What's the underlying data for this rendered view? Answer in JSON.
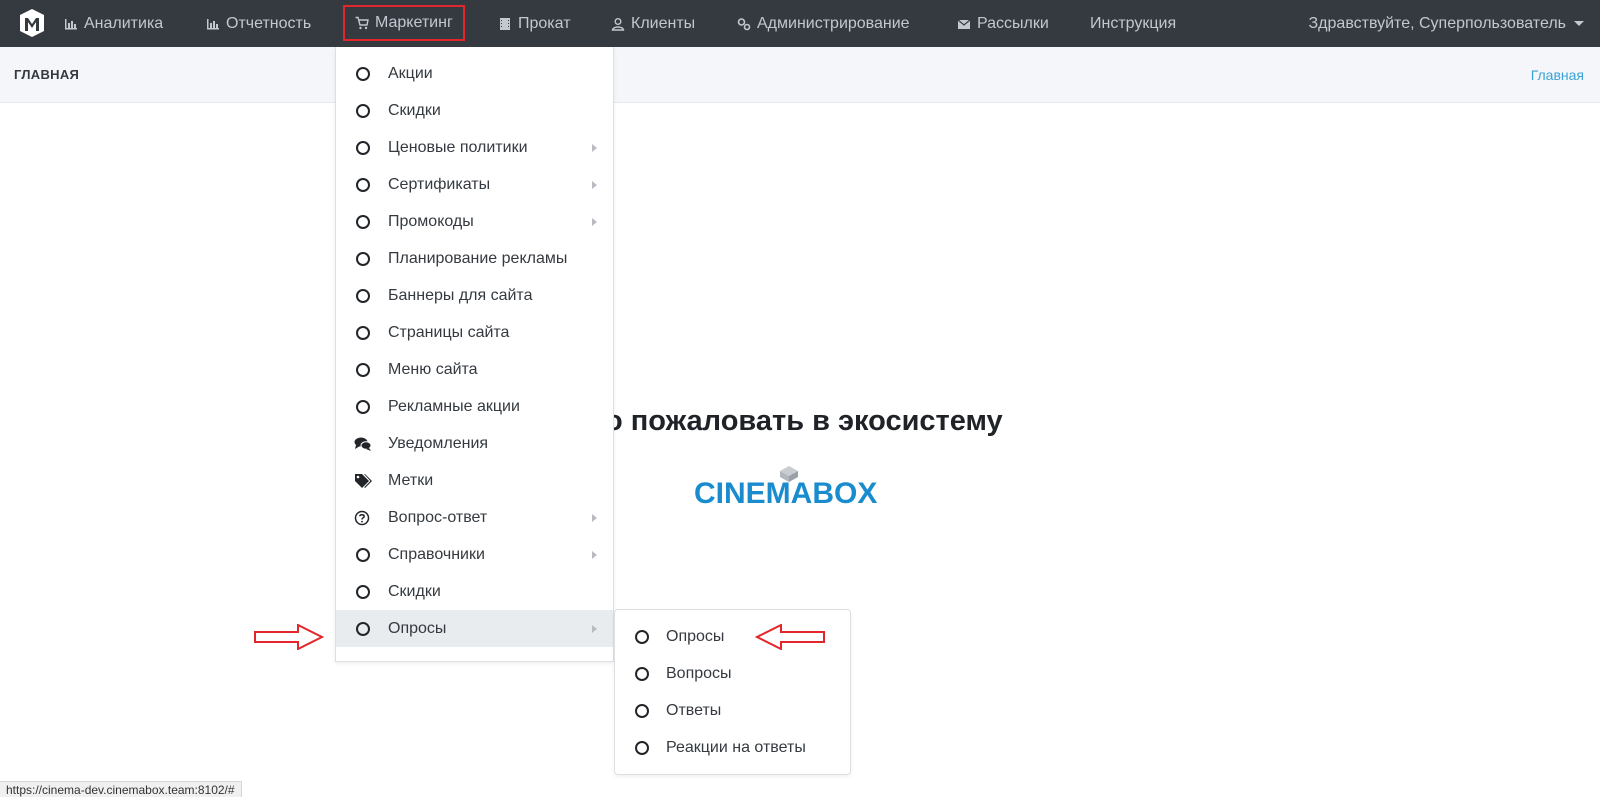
{
  "navbar": {
    "items": [
      {
        "label": "Аналитика",
        "icon": "bar-chart-icon"
      },
      {
        "label": "Отчетность",
        "icon": "bar-chart-icon"
      },
      {
        "label": "Маркетинг",
        "icon": "cart-icon"
      },
      {
        "label": "Прокат",
        "icon": "film-icon"
      },
      {
        "label": "Клиенты",
        "icon": "user-icon"
      },
      {
        "label": "Администрирование",
        "icon": "gears-icon"
      },
      {
        "label": "Рассылки",
        "icon": "envelope-icon"
      },
      {
        "label": "Инструкция",
        "icon": ""
      }
    ],
    "user_greeting": "Здравствуйте, Суперпользователь"
  },
  "header": {
    "title": "ГЛАВНАЯ",
    "breadcrumb": "Главная"
  },
  "main": {
    "welcome_text": "о пожаловать в экосистему",
    "logo_text": "CINEMABOX"
  },
  "marketing_menu": {
    "items": [
      {
        "label": "Акции",
        "icon": "circle-icon",
        "has_submenu": false
      },
      {
        "label": "Скидки",
        "icon": "circle-icon",
        "has_submenu": false
      },
      {
        "label": "Ценовые политики",
        "icon": "circle-icon",
        "has_submenu": true
      },
      {
        "label": "Сертификаты",
        "icon": "circle-icon",
        "has_submenu": true
      },
      {
        "label": "Промокоды",
        "icon": "circle-icon",
        "has_submenu": true
      },
      {
        "label": "Планирование рекламы",
        "icon": "circle-icon",
        "has_submenu": false
      },
      {
        "label": "Баннеры для сайта",
        "icon": "circle-icon",
        "has_submenu": false
      },
      {
        "label": "Страницы сайта",
        "icon": "circle-icon",
        "has_submenu": false
      },
      {
        "label": "Меню сайта",
        "icon": "circle-icon",
        "has_submenu": false
      },
      {
        "label": "Рекламные акции",
        "icon": "circle-icon",
        "has_submenu": false
      },
      {
        "label": "Уведомления",
        "icon": "comments-icon",
        "has_submenu": false
      },
      {
        "label": "Метки",
        "icon": "tags-icon",
        "has_submenu": false
      },
      {
        "label": "Вопрос-ответ",
        "icon": "question-circle-icon",
        "has_submenu": true
      },
      {
        "label": "Справочники",
        "icon": "circle-icon",
        "has_submenu": true
      },
      {
        "label": "Скидки",
        "icon": "circle-icon",
        "has_submenu": false
      },
      {
        "label": "Опросы",
        "icon": "circle-icon",
        "has_submenu": true
      }
    ]
  },
  "surveys_submenu": {
    "items": [
      {
        "label": "Опросы"
      },
      {
        "label": "Вопросы"
      },
      {
        "label": "Ответы"
      },
      {
        "label": "Реакции на ответы"
      }
    ]
  },
  "status_bar": {
    "url": "https://cinema-dev.cinemabox.team:8102/#"
  },
  "colors": {
    "navbar_bg": "#343a40",
    "highlight_red": "#e3262b",
    "link_blue": "#3aa3d6",
    "logo_blue": "#1a8ccd"
  }
}
